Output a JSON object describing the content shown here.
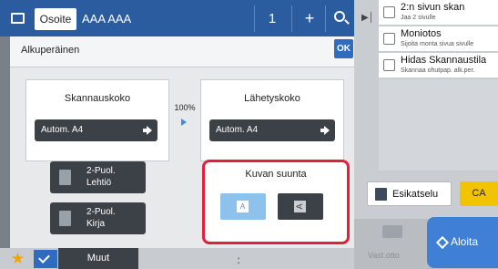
{
  "address_bar": {
    "label": "Osoite",
    "value": "AAA AAA",
    "count": "1",
    "plus": "+"
  },
  "dialog": {
    "title": "Alkuperäinen",
    "ok": "OK",
    "scan_size": {
      "title": "Skannauskoko",
      "value": "Autom.   A4"
    },
    "send_size": {
      "title": "Lähetyskoko",
      "value": "Autom.   A4"
    },
    "ratio": "100%",
    "duplex_tablet": {
      "line1": "2-Puol.",
      "line2": "Lehtiö"
    },
    "duplex_book": {
      "line1": "2-Puol.",
      "line2": "Kirja"
    },
    "orientation": {
      "title": "Kuvan suunta",
      "option_a_glyph": "A",
      "option_b_glyph": "A"
    }
  },
  "side_panel": {
    "items": [
      {
        "title": "2:n sivun skan",
        "subtitle": "Jaa 2 sivulle"
      },
      {
        "title": "Moniotos",
        "subtitle": "Sijoita monta sivua sivulle"
      },
      {
        "title": "Hidas Skannaustila",
        "subtitle": "Skannaa ohutpap. alk.per."
      }
    ],
    "preview": "Esikatselu",
    "ca": "CA",
    "copy": "Vast.otto",
    "start": "Aloita"
  },
  "bottom_bar": {
    "other": "Muut"
  },
  "colors": {
    "top_bar": "#2b5ca0",
    "highlight_border": "#e0213e",
    "start_button": "#3f7fd6",
    "ca_button": "#f2c400",
    "selected_option": "#8cc2ec"
  }
}
